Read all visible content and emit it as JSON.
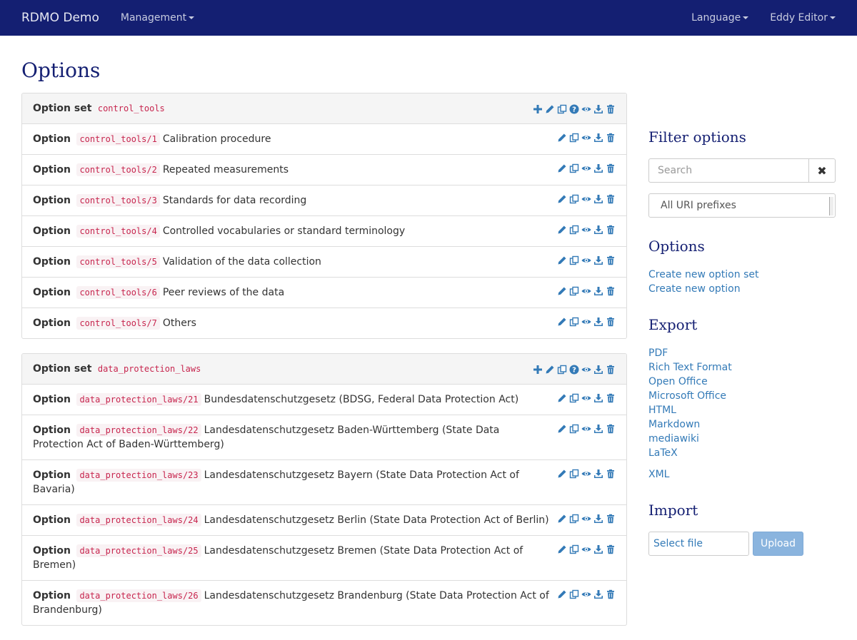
{
  "navbar": {
    "brand": "RDMO Demo",
    "management": "Management",
    "language": "Language",
    "user": "Eddy Editor"
  },
  "page": {
    "title": "Options"
  },
  "option_sets": [
    {
      "kind": "Option set",
      "key": "control_tools",
      "options": [
        {
          "kind": "Option",
          "key": "control_tools/1",
          "text": "Calibration procedure"
        },
        {
          "kind": "Option",
          "key": "control_tools/2",
          "text": "Repeated measurements"
        },
        {
          "kind": "Option",
          "key": "control_tools/3",
          "text": "Standards for data recording"
        },
        {
          "kind": "Option",
          "key": "control_tools/4",
          "text": "Controlled vocabularies or standard terminology"
        },
        {
          "kind": "Option",
          "key": "control_tools/5",
          "text": "Validation of the data collection"
        },
        {
          "kind": "Option",
          "key": "control_tools/6",
          "text": "Peer reviews of the data"
        },
        {
          "kind": "Option",
          "key": "control_tools/7",
          "text": "Others"
        }
      ]
    },
    {
      "kind": "Option set",
      "key": "data_protection_laws",
      "options": [
        {
          "kind": "Option",
          "key": "data_protection_laws/21",
          "text": "Bundesdatenschutzgesetz (BDSG, Federal Data Protection Act)"
        },
        {
          "kind": "Option",
          "key": "data_protection_laws/22",
          "text": "Landesdatenschutzgesetz Baden-Württemberg (State Data Protection Act of Baden-Württemberg)"
        },
        {
          "kind": "Option",
          "key": "data_protection_laws/23",
          "text": "Landesdatenschutzgesetz Bayern (State Data Protection Act of Bavaria)"
        },
        {
          "kind": "Option",
          "key": "data_protection_laws/24",
          "text": "Landesdatenschutzgesetz Berlin (State Data Protection Act of Berlin)"
        },
        {
          "kind": "Option",
          "key": "data_protection_laws/25",
          "text": "Landesdatenschutzgesetz Bremen (State Data Protection Act of Bremen)"
        },
        {
          "kind": "Option",
          "key": "data_protection_laws/26",
          "text": "Landesdatenschutzgesetz Brandenburg (State Data Protection Act of Brandenburg)"
        }
      ]
    }
  ],
  "icons": {
    "set": [
      "plus-icon",
      "pencil-icon",
      "copy-icon",
      "question-icon",
      "eye-icon",
      "download-icon",
      "trash-icon"
    ],
    "option": [
      "pencil-icon",
      "copy-icon",
      "eye-icon",
      "download-icon",
      "trash-icon"
    ],
    "color": "#337ab7"
  },
  "sidebar": {
    "filter_title": "Filter options",
    "search_placeholder": "Search",
    "clear_symbol": "✖",
    "uri_prefix": "All URI prefixes",
    "options_title": "Options",
    "options_links": [
      "Create new option set",
      "Create new option"
    ],
    "export_title": "Export",
    "export_links": [
      "PDF",
      "Rich Text Format",
      "Open Office",
      "Microsoft Office",
      "HTML",
      "Markdown",
      "mediawiki",
      "LaTeX"
    ],
    "export_xml": "XML",
    "import_title": "Import",
    "select_file": "Select file",
    "upload": "Upload"
  },
  "colors": {
    "navbar": "#141f72",
    "heading": "#141f72",
    "link": "#337ab7",
    "code": "#c7254e"
  }
}
